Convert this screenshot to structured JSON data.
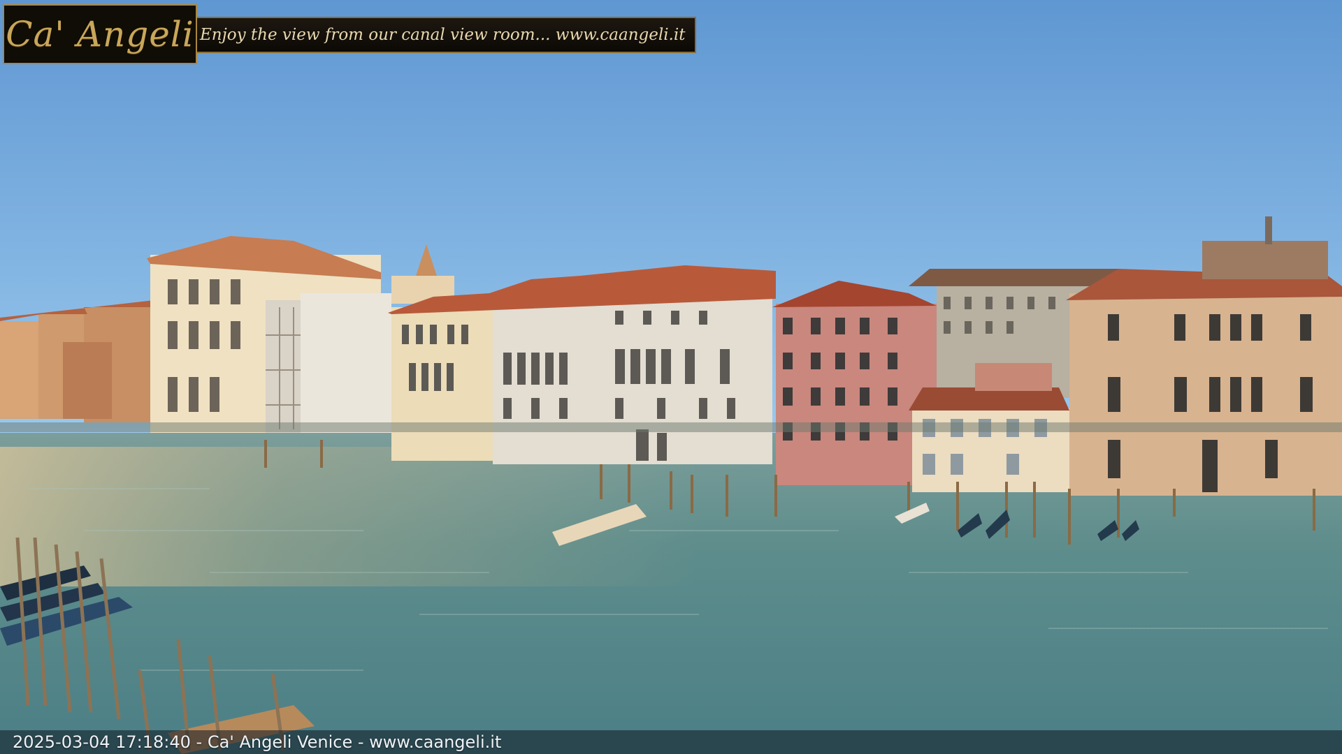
{
  "overlay": {
    "logo_text": "Ca' Angeli",
    "tagline": "Enjoy the view from our canal view room... www.caangeli.it",
    "footer": "2025-03-04 17:18:40 - Ca' Angeli Venice - www.caangeli.it"
  },
  "scene": {
    "subject": "Grand Canal, Venice",
    "sky_color": "#79b2e6",
    "water_color": "#5a8c8a"
  }
}
